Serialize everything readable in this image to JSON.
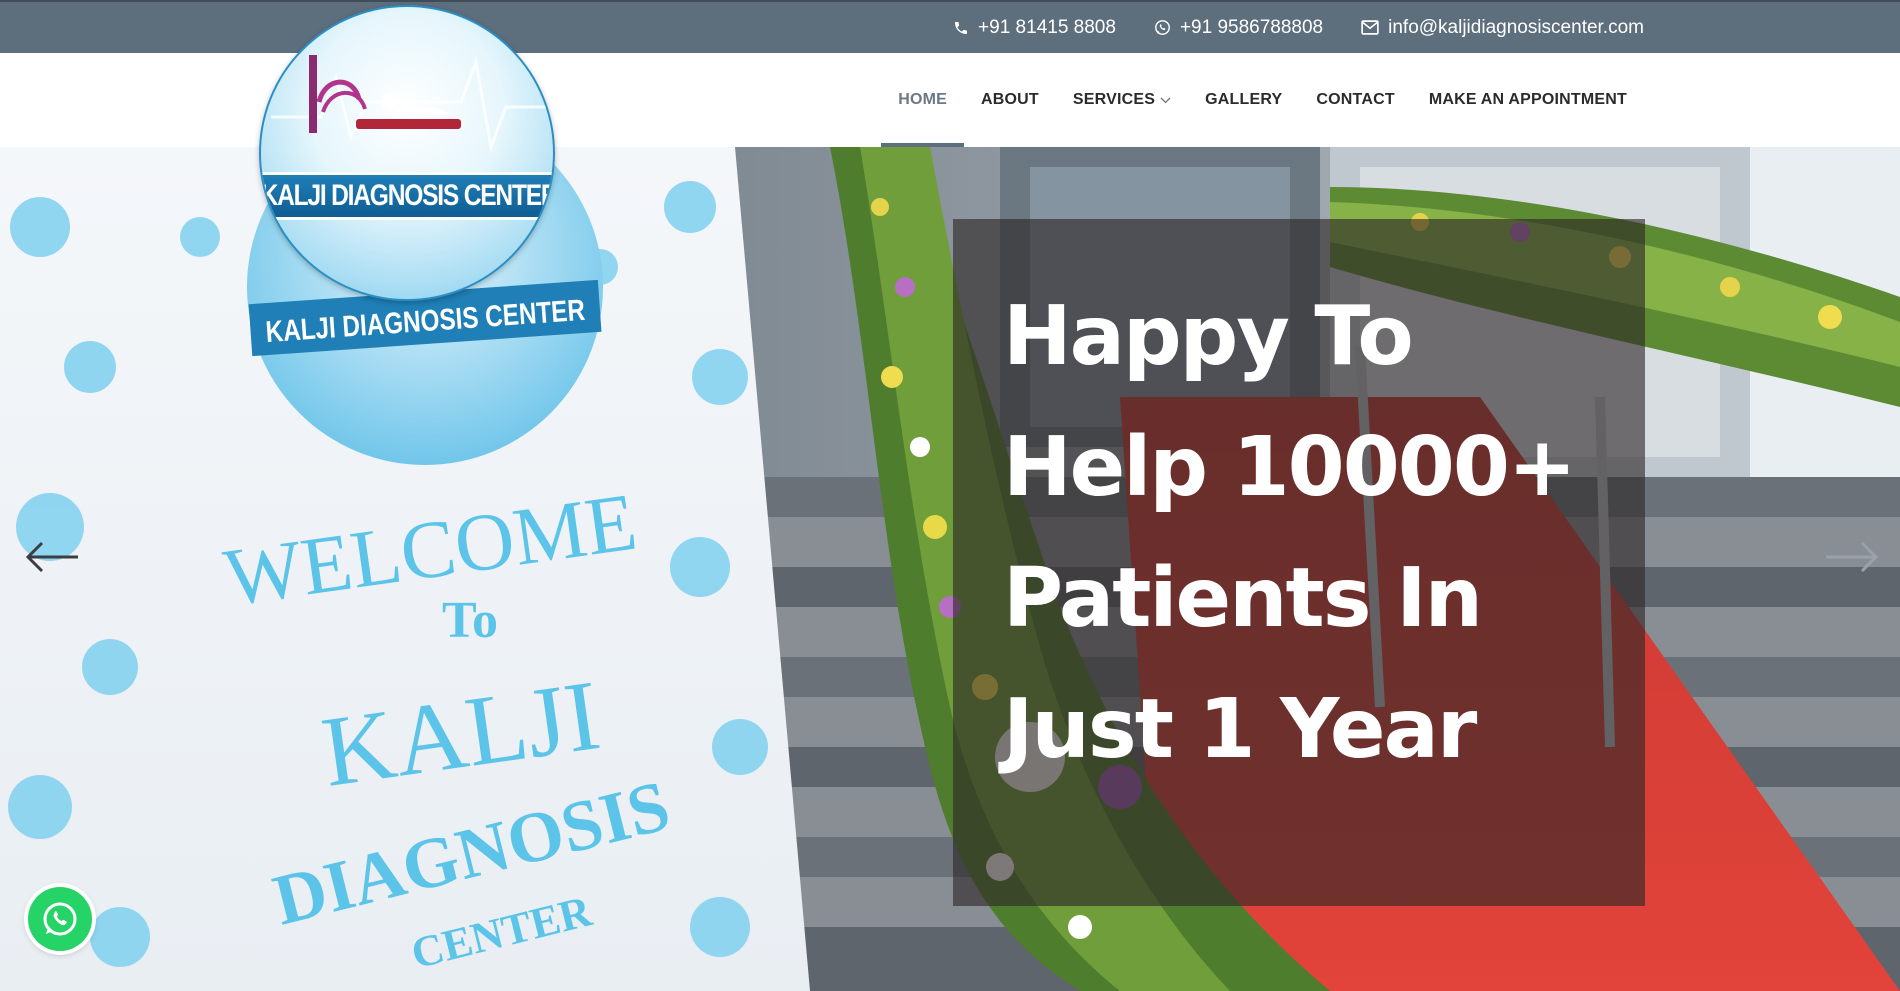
{
  "topbar": {
    "phone_1": "+91 81415 8808",
    "phone_2": "+91 9586788808",
    "email": "info@kaljidiagnosiscenter.com",
    "icons": [
      "phone-icon",
      "whatsapp-icon",
      "envelope-icon"
    ]
  },
  "logo": {
    "text": "KALJI DIAGNOSIS CENTER"
  },
  "nav": {
    "home": "HOME",
    "about": "ABOUT",
    "services": "SERVICES",
    "gallery": "GALLERY",
    "contact": "CONTACT",
    "appointment": "MAKE AN APPOINTMENT",
    "active": "HOME"
  },
  "hero": {
    "headline": "Happy To Help 10000+ Patients In Just 1 Year",
    "banner": {
      "logo_text": "KALJI DIAGNOSIS CENTER",
      "line_1": "WELCOME",
      "line_2": "To",
      "line_3": "KALJI",
      "line_4": "DIAGNOSIS",
      "line_5": "CENTER"
    },
    "prev_icon": "arrow-left-icon",
    "next_icon": "arrow-right-icon"
  },
  "floating": {
    "whatsapp_icon": "whatsapp-icon"
  },
  "colors": {
    "topbar": "#5d6e7d",
    "nav_text": "#2b2b2b",
    "nav_active": "#6c7884",
    "caption_overlay": "rgba(45,38,38,0.62)",
    "banner_text": "#5cc4e8",
    "carpet": "#d8352f",
    "whatsapp": "#25d366"
  }
}
